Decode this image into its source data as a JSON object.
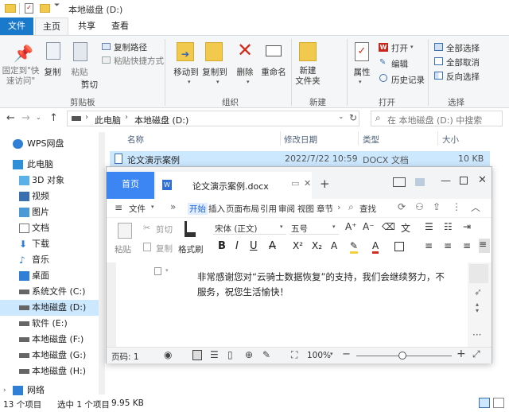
{
  "window": {
    "title": "本地磁盘 (D:)"
  },
  "ribbon_tabs": [
    "文件",
    "主页",
    "共享",
    "查看"
  ],
  "ribbon": {
    "clipboard": {
      "pin": "固定到\"快\n速访问\"",
      "copy": "复制",
      "paste": "粘贴",
      "copy_path": "复制路径",
      "paste_shortcut": "粘贴快捷方式",
      "cut": "剪切",
      "group": "剪贴板"
    },
    "organize": {
      "move_to": "移动到",
      "copy_to": "复制到",
      "delete": "删除",
      "rename": "重命名",
      "group": "组织"
    },
    "new": {
      "new_folder": "新建\n文件夹",
      "group": "新建"
    },
    "open": {
      "properties": "属性",
      "open": "打开",
      "edit": "编辑",
      "history": "历史记录",
      "group": "打开"
    },
    "select": {
      "select_all": "全部选择",
      "select_none": "全部取消",
      "invert": "反向选择",
      "group": "选择"
    }
  },
  "address": {
    "path": [
      "此电脑",
      "本地磁盘 (D:)"
    ],
    "search_placeholder": "在 本地磁盘 (D:) 中搜索"
  },
  "nav": [
    {
      "label": "WPS网盘",
      "icon": "cloud-icon"
    },
    {
      "label": "此电脑",
      "icon": "computer-icon"
    },
    {
      "label": "3D 对象",
      "icon": "cube-icon"
    },
    {
      "label": "视频",
      "icon": "video-icon"
    },
    {
      "label": "图片",
      "icon": "picture-icon"
    },
    {
      "label": "文档",
      "icon": "document-icon"
    },
    {
      "label": "下载",
      "icon": "download-icon"
    },
    {
      "label": "音乐",
      "icon": "music-icon"
    },
    {
      "label": "桌面",
      "icon": "desktop-icon"
    },
    {
      "label": "系统文件 (C:)",
      "icon": "drive-icon"
    },
    {
      "label": "本地磁盘 (D:)",
      "icon": "drive-icon"
    },
    {
      "label": "软件 (E:)",
      "icon": "drive-icon"
    },
    {
      "label": "本地磁盘 (F:)",
      "icon": "drive-icon"
    },
    {
      "label": "本地磁盘 (G:)",
      "icon": "drive-icon"
    },
    {
      "label": "本地磁盘 (H:)",
      "icon": "drive-icon"
    },
    {
      "label": "网络",
      "icon": "network-icon"
    }
  ],
  "columns": [
    "名称",
    "修改日期",
    "类型",
    "大小"
  ],
  "files": [
    {
      "name": "论文演示案例",
      "date": "2022/7/22 10:59",
      "type": "DOCX 文档",
      "size": "10 KB"
    }
  ],
  "status": {
    "count": "13 个项目",
    "selected": "选中 1 个项目",
    "size": "9.95 KB"
  },
  "wps": {
    "home_tab": "首页",
    "doc_tab": "论文演示案例.docx",
    "menu": [
      "文件",
      "开始",
      "插入",
      "页面布局",
      "引用",
      "审阅",
      "视图",
      "章节"
    ],
    "search": "查找",
    "tools": {
      "paste": "粘贴",
      "cut": "剪切",
      "copy": "复制",
      "format": "格式刷",
      "font": "宋体 (正文)",
      "size": "五号"
    },
    "doc_text": [
      "非常感谢您对“云骑士数据恢复”的支持，我们会继续努力，不",
      "服务，祝您生活愉快！"
    ],
    "page": "页码: 1",
    "zoom": "100%"
  },
  "colors": {
    "accent": "#1979ca",
    "wps_tab": "#3b86f3",
    "selected": "#cce8ff"
  }
}
